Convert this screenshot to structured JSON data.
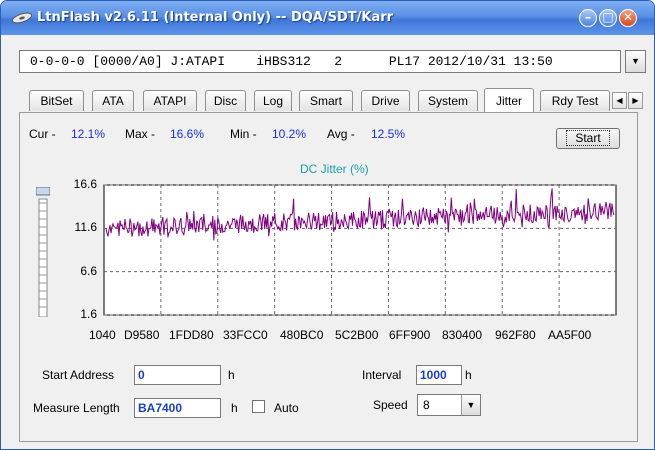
{
  "window": {
    "title": "LtnFlash v2.6.11 (Internal Only) -- DQA/SDT/Karr",
    "minimize_glyph": "–",
    "maximize_glyph": "□",
    "close_glyph": "✕"
  },
  "device": {
    "selected": "0-0-0-0 [0000/A0] J:ATAPI    iHBS312   2      PL17 2012/10/31 13:50",
    "arrow_glyph": "▼"
  },
  "tabs": [
    {
      "label": "BitSet"
    },
    {
      "label": "ATA"
    },
    {
      "label": "ATAPI"
    },
    {
      "label": "Disc"
    },
    {
      "label": "Log"
    },
    {
      "label": "Smart"
    },
    {
      "label": "Drive"
    },
    {
      "label": "System"
    },
    {
      "label": "Jitter",
      "active": true
    },
    {
      "label": "Rdy Test"
    }
  ],
  "tab_scroll": {
    "left_glyph": "◀",
    "right_glyph": "▶"
  },
  "stats": {
    "cur_label": "Cur -",
    "cur_value": "12.1%",
    "max_label": "Max -",
    "max_value": "16.6%",
    "min_label": "Min -",
    "min_value": "10.2%",
    "avg_label": "Avg -",
    "avg_value": "12.5%"
  },
  "start_button": "Start",
  "chart_data": {
    "type": "line",
    "title": "DC Jitter (%)",
    "y_ticks": [
      "16.6",
      "11.6",
      "6.6",
      "1.6"
    ],
    "ylim": [
      1.6,
      16.6
    ],
    "x_ticks": [
      "1040",
      "D9580",
      "1FDD80",
      "33FCC0",
      "480BC0",
      "5C2B00",
      "6FF900",
      "830400",
      "962F80",
      "AA5F00"
    ],
    "grid": true,
    "line_color": "#800080",
    "series": [
      {
        "trend_start": 11.6,
        "trend_end": 13.6,
        "noise_min": 10.2,
        "noise_max": 16.6,
        "values_summary": {
          "current": 12.1,
          "max": 16.6,
          "min": 10.2,
          "avg": 12.5
        }
      }
    ]
  },
  "form": {
    "start_address_label": "Start Address",
    "start_address_value": "0",
    "start_address_unit": "h",
    "measure_length_label": "Measure Length",
    "measure_length_value": "BA7400",
    "measure_length_unit": "h",
    "auto_label": "Auto",
    "interval_label": "Interval",
    "interval_value": "1000",
    "interval_unit": "h",
    "speed_label": "Speed",
    "speed_value": "8",
    "speed_arrow_glyph": "▼"
  },
  "colors": {
    "value_blue": "#1a2fe0",
    "chart_title": "#1aa0a8",
    "titlebar": "#4a82e0"
  }
}
